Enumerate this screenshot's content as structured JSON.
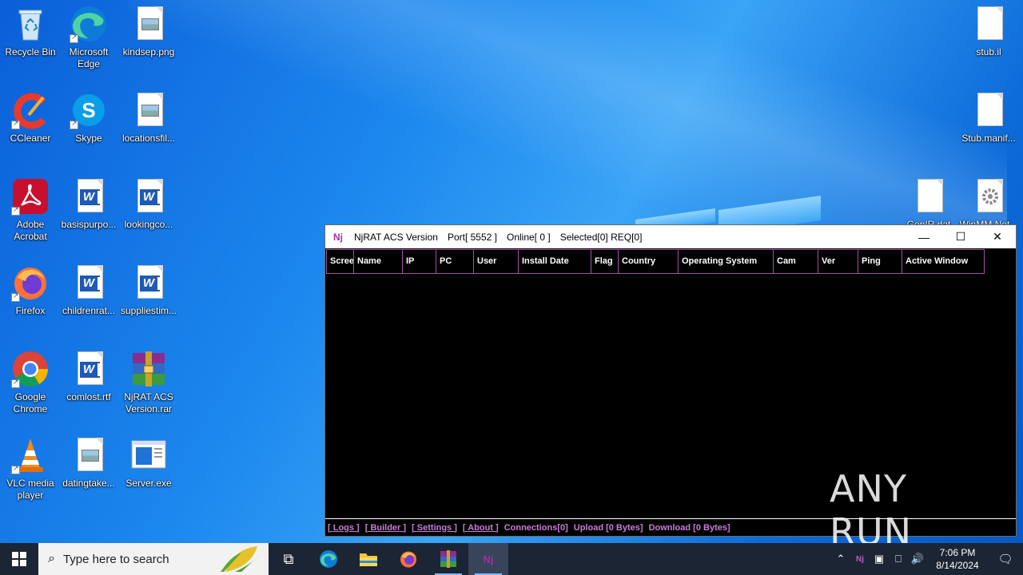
{
  "desktop": {
    "icons": [
      {
        "label": "Recycle Bin"
      },
      {
        "label": "Microsoft Edge"
      },
      {
        "label": "kindsep.png"
      },
      {
        "label": "CCleaner"
      },
      {
        "label": "Skype"
      },
      {
        "label": "locationsfil..."
      },
      {
        "label": "Adobe Acrobat"
      },
      {
        "label": "basispurpo..."
      },
      {
        "label": "lookingco..."
      },
      {
        "label": "Firefox"
      },
      {
        "label": "childrenrat..."
      },
      {
        "label": "suppliestim..."
      },
      {
        "label": "Google Chrome"
      },
      {
        "label": "comlost.rtf"
      },
      {
        "label": "NjRAT ACS Version.rar"
      },
      {
        "label": "VLC media player"
      },
      {
        "label": "datingtake..."
      },
      {
        "label": "Server.exe"
      },
      {
        "label": "stub.il"
      },
      {
        "label": "Stub.manif..."
      },
      {
        "label": "GenIR.dat"
      },
      {
        "label": "WinMM.Net..."
      }
    ]
  },
  "njrat": {
    "title": "NjRAT ACS Version",
    "port": "Port[ 5552 ]",
    "online": "Online[ 0 ]",
    "selected": "Selected[0] REQ[0]",
    "columns": [
      "Scree",
      "Name",
      "IP",
      "PC",
      "User",
      "Install Date",
      "Flag",
      "Country",
      "Operating System",
      "Cam",
      "Ver",
      "Ping",
      "Active Window"
    ],
    "status": {
      "logs": "[ Logs ]",
      "builder": "[ Builder ]",
      "settings": "[ Settings ]",
      "about": "[ About ]",
      "connections": "Connections[0]",
      "upload": "Upload [0 Bytes]",
      "download": "Download [0 Bytes]"
    }
  },
  "watermark": "ANY RUN",
  "taskbar": {
    "search_placeholder": "Type here to search",
    "time": "7:06 PM",
    "date": "8/14/2024"
  },
  "colors": {
    "accent_purple": "#c77dd7",
    "header_border": "#a250a2",
    "taskbar": "#1b2534"
  }
}
